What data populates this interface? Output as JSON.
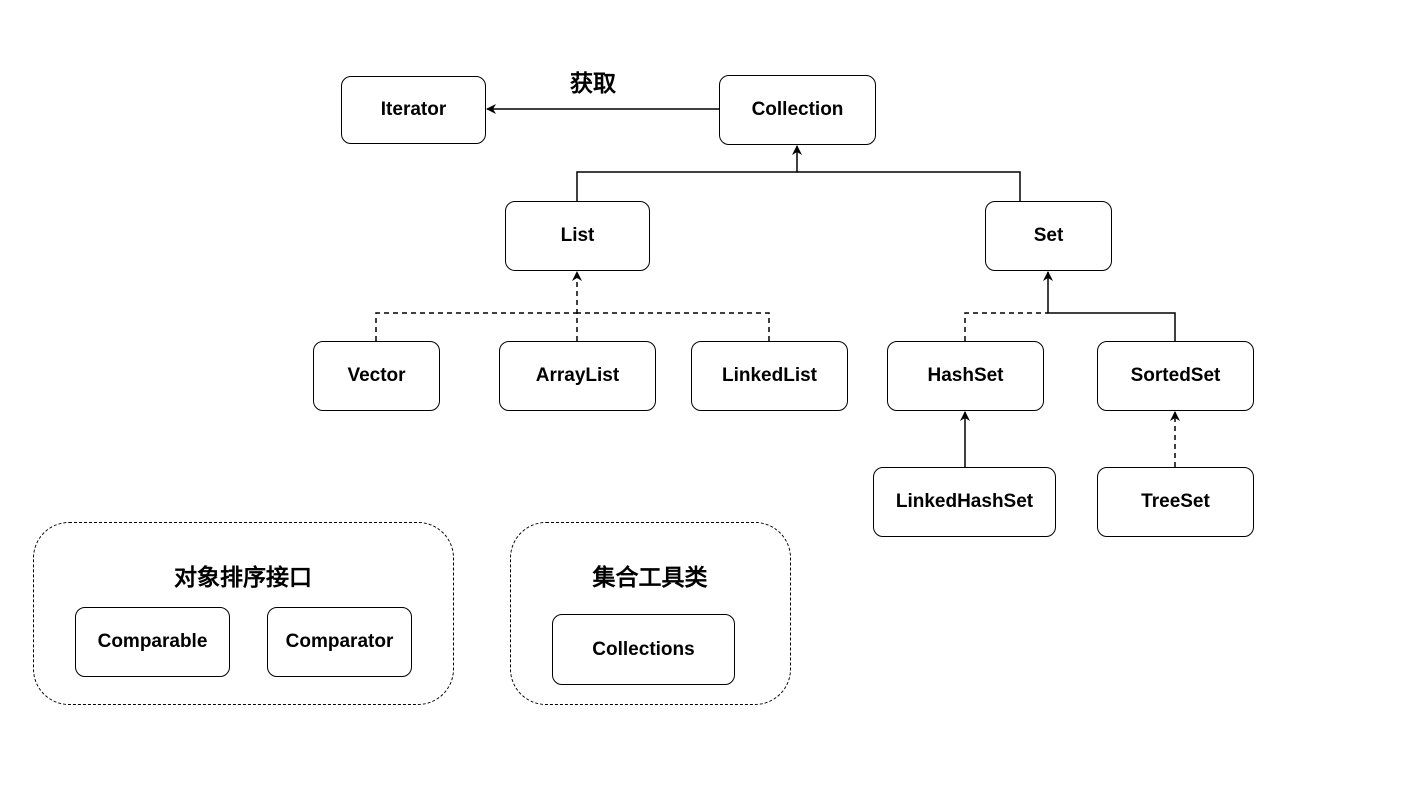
{
  "edge_label": "获取",
  "nodes": {
    "iterator": "Iterator",
    "collection": "Collection",
    "list": "List",
    "set": "Set",
    "vector": "Vector",
    "arraylist": "ArrayList",
    "linkedlist": "LinkedList",
    "hashset": "HashSet",
    "sortedset": "SortedSet",
    "linkedhashset": "LinkedHashSet",
    "treeset": "TreeSet"
  },
  "groups": {
    "sorting": {
      "title": "对象排序接口",
      "items": [
        "Comparable",
        "Comparator"
      ]
    },
    "utils": {
      "title": "集合工具类",
      "items": [
        "Collections"
      ]
    }
  }
}
